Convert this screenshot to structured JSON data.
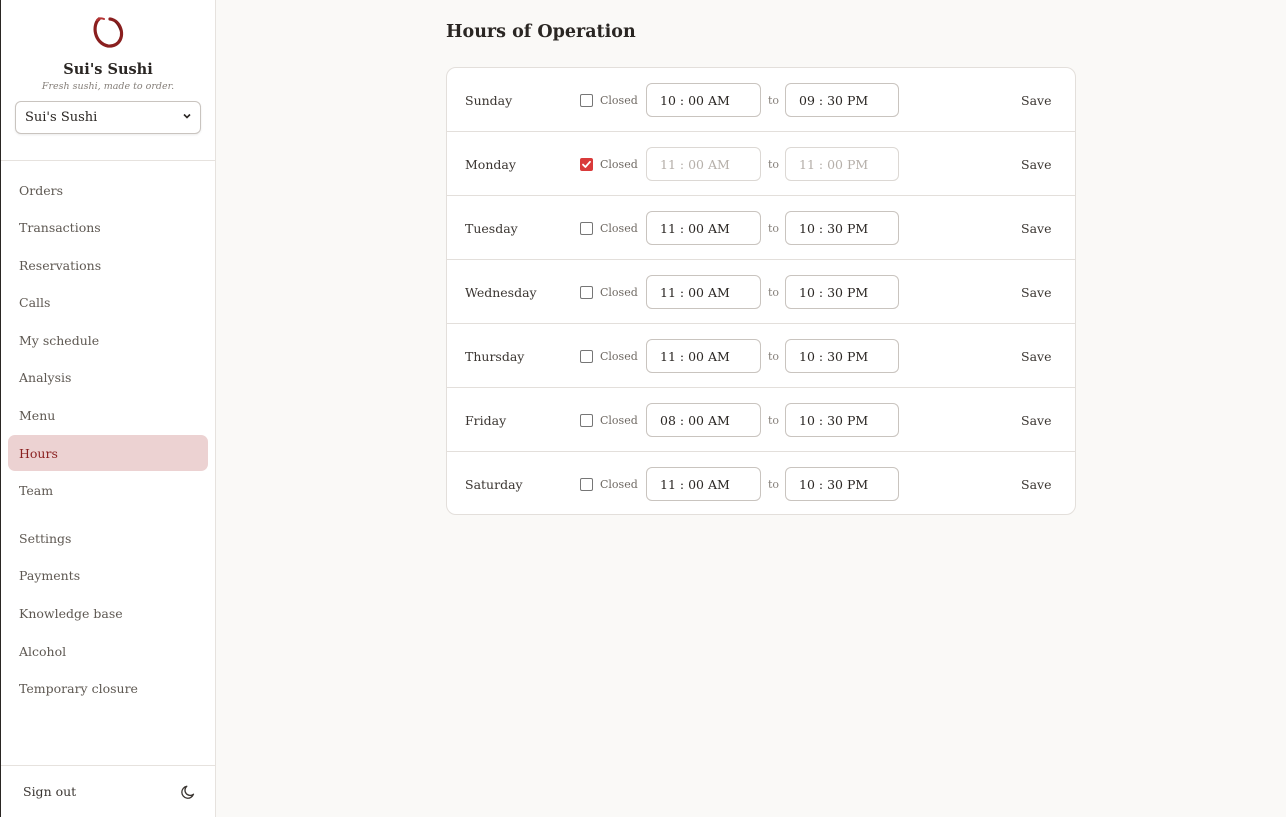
{
  "brand": {
    "name": "Sui's Sushi",
    "tagline": "Fresh sushi, made to order.",
    "selected_restaurant": "Sui's Sushi",
    "accent_color": "#8a1f1f"
  },
  "nav": {
    "items": [
      {
        "label": "Orders"
      },
      {
        "label": "Transactions"
      },
      {
        "label": "Reservations"
      },
      {
        "label": "Calls"
      },
      {
        "label": "My schedule"
      },
      {
        "label": "Analysis"
      },
      {
        "label": "Menu"
      },
      {
        "label": "Hours",
        "active": true
      },
      {
        "label": "Team"
      },
      {
        "label": "Settings"
      },
      {
        "label": "Payments"
      },
      {
        "label": "Knowledge base"
      },
      {
        "label": "Alcohol"
      },
      {
        "label": "Temporary closure"
      }
    ]
  },
  "footer": {
    "sign_out": "Sign out",
    "theme_icon": "moon-icon"
  },
  "page": {
    "title": "Hours of Operation",
    "closed_label": "Closed",
    "to_label": "to",
    "save_label": "Save",
    "days": [
      {
        "name": "Sunday",
        "closed": false,
        "open": "10 : 00  AM",
        "close": "09 : 30  PM"
      },
      {
        "name": "Monday",
        "closed": true,
        "open": "11 : 00  AM",
        "close": "11 : 00  PM"
      },
      {
        "name": "Tuesday",
        "closed": false,
        "open": "11 : 00  AM",
        "close": "10 : 30  PM"
      },
      {
        "name": "Wednesday",
        "closed": false,
        "open": "11 : 00  AM",
        "close": "10 : 30  PM"
      },
      {
        "name": "Thursday",
        "closed": false,
        "open": "11 : 00  AM",
        "close": "10 : 30  PM"
      },
      {
        "name": "Friday",
        "closed": false,
        "open": "08 : 00  AM",
        "close": "10 : 30  PM"
      },
      {
        "name": "Saturday",
        "closed": false,
        "open": "11 : 00  AM",
        "close": "10 : 30  PM"
      }
    ]
  }
}
